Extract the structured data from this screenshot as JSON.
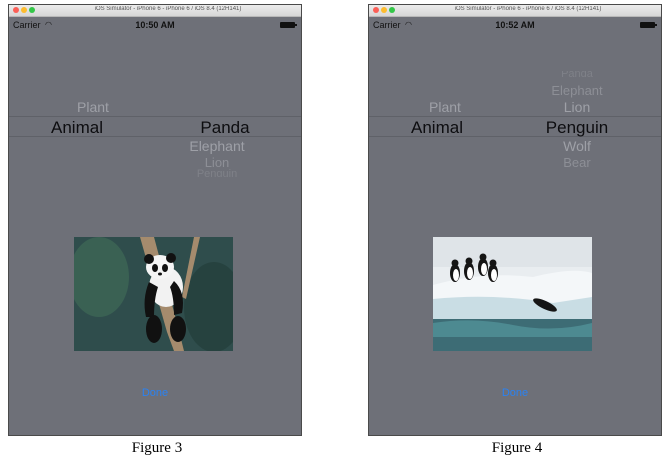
{
  "screens": [
    {
      "title_bar": "iOS Simulator - iPhone 6 - iPhone 6 / iOS 8.4 (12H141)",
      "status_bar": {
        "carrier": "Carrier",
        "time": "10:50 AM"
      },
      "picker": {
        "col1": {
          "above": [
            "Plant"
          ],
          "selected": "Animal",
          "below": []
        },
        "col2": {
          "above": [],
          "selected": "Panda",
          "below": [
            "Elephant",
            "Lion",
            "Penguin"
          ]
        }
      },
      "image": "panda-photo",
      "done_label": "Done",
      "caption": "Figure 3"
    },
    {
      "title_bar": "iOS Simulator - iPhone 6 - iPhone 6 / iOS 8.4 (12H141)",
      "status_bar": {
        "carrier": "Carrier",
        "time": "10:52 AM"
      },
      "picker": {
        "col1": {
          "above": [
            "Plant"
          ],
          "selected": "Animal",
          "below": []
        },
        "col2": {
          "above": [
            "Panda",
            "Elephant",
            "Lion"
          ],
          "selected": "Penguin",
          "below": [
            "Wolf",
            "Bear"
          ]
        }
      },
      "image": "penguin-photo",
      "done_label": "Done",
      "caption": "Figure 4"
    }
  ],
  "colors": {
    "simulator_bg": "#6e7078",
    "done": "#2a82f2"
  }
}
